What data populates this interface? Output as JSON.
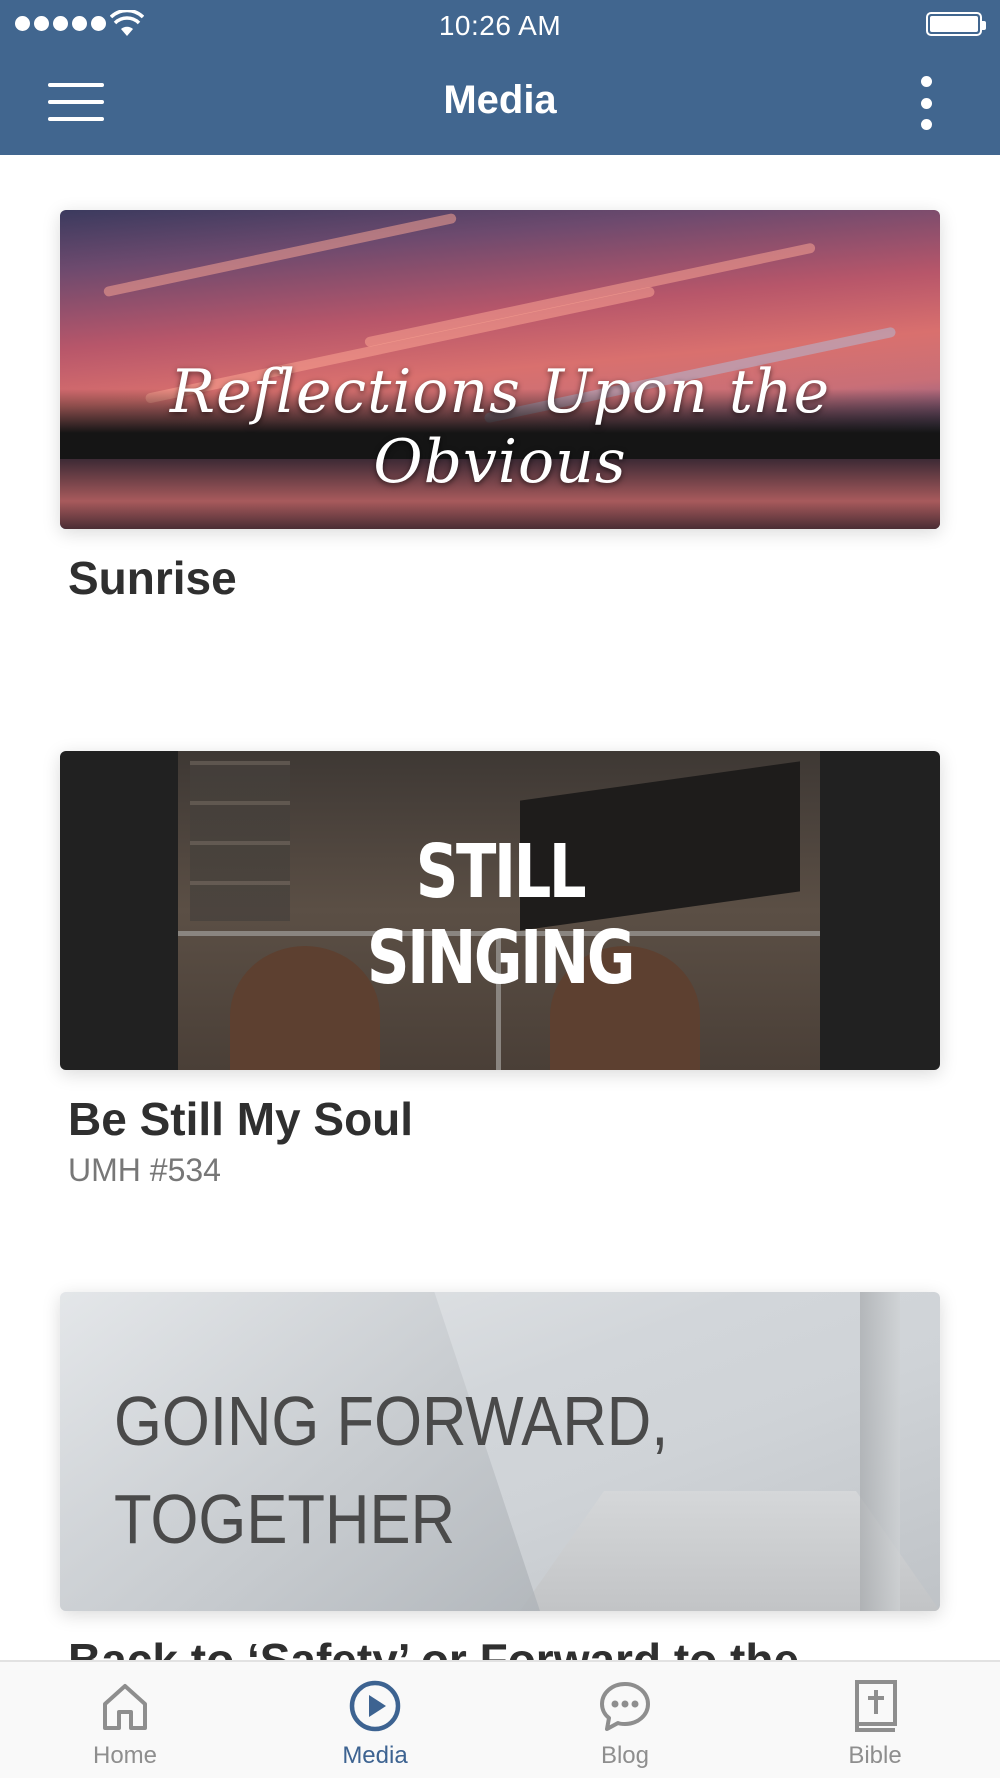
{
  "status_bar": {
    "time": "10:26 AM"
  },
  "header": {
    "title": "Media",
    "menu_icon": "hamburger-menu-icon",
    "more_icon": "more-vertical-icon"
  },
  "colors": {
    "header_bg": "#41668f",
    "active_tab": "#3d6391",
    "inactive_tab": "#8e8e8e"
  },
  "media_items": [
    {
      "thumbnail_text": "Reflections Upon the Obvious",
      "title": "Sunrise",
      "subtitle": ""
    },
    {
      "thumbnail_text": [
        "STILL",
        "SINGING"
      ],
      "title": "Be Still My Soul",
      "subtitle": "UMH #534"
    },
    {
      "thumbnail_text": [
        "GOING FORWARD,",
        "TOGETHER"
      ],
      "title": "Back to ‘Safety’ or Forward to the",
      "subtitle": ""
    }
  ],
  "tabs": [
    {
      "label": "Home",
      "icon": "home-icon",
      "active": false
    },
    {
      "label": "Media",
      "icon": "play-circle-icon",
      "active": true
    },
    {
      "label": "Blog",
      "icon": "chat-bubble-icon",
      "active": false
    },
    {
      "label": "Bible",
      "icon": "bible-icon",
      "active": false
    }
  ]
}
